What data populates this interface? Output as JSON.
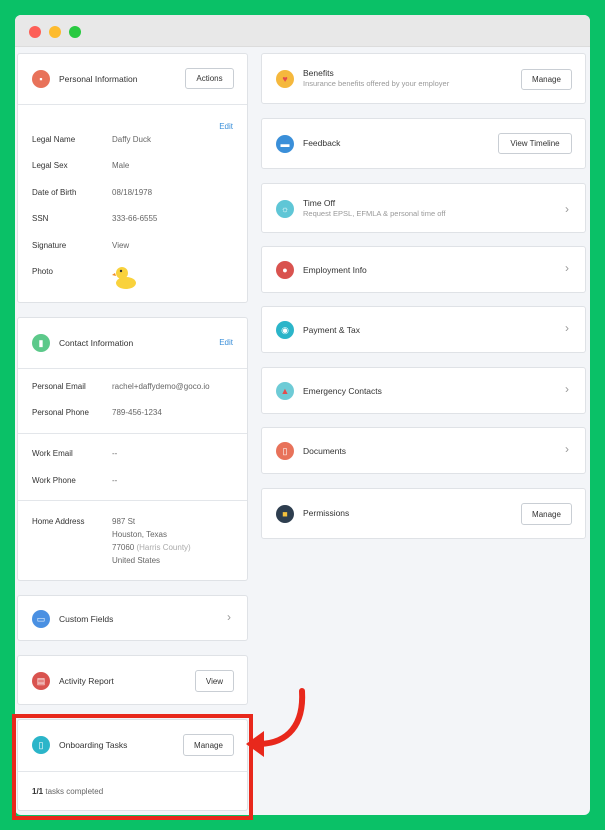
{
  "personal_info": {
    "title": "Personal Information",
    "actions_label": "Actions",
    "edit_label": "Edit",
    "fields": [
      {
        "label": "Legal Name",
        "value": "Daffy Duck"
      },
      {
        "label": "Legal Sex",
        "value": "Male"
      },
      {
        "label": "Date of Birth",
        "value": "08/18/1978"
      },
      {
        "label": "SSN",
        "value": "333-66-6555"
      },
      {
        "label": "Signature",
        "value": "View"
      },
      {
        "label": "Photo",
        "value": ""
      }
    ]
  },
  "contact_info": {
    "title": "Contact Information",
    "edit_label": "Edit",
    "personal_email_label": "Personal Email",
    "personal_email": "rachel+daffydemo@goco.io",
    "personal_phone_label": "Personal Phone",
    "personal_phone": "789-456-1234",
    "work_email_label": "Work Email",
    "work_email": "--",
    "work_phone_label": "Work Phone",
    "work_phone": "--",
    "home_address_label": "Home Address",
    "address_line1": "987 St",
    "address_line2": "Houston, Texas",
    "address_zip": "77060",
    "address_county": "(Harris County)",
    "address_country": "United States"
  },
  "custom_fields": {
    "title": "Custom Fields"
  },
  "activity_report": {
    "title": "Activity Report",
    "button_label": "View"
  },
  "onboarding": {
    "title": "Onboarding Tasks",
    "button_label": "Manage",
    "progress_count": "1/1",
    "progress_text": " tasks completed"
  },
  "right_cards": {
    "benefits": {
      "title": "Benefits",
      "subtitle": "Insurance benefits offered by your employer",
      "button_label": "Manage"
    },
    "feedback": {
      "title": "Feedback",
      "button_label": "View Timeline"
    },
    "time_off": {
      "title": "Time Off",
      "subtitle": "Request EPSL, EFMLA & personal time off"
    },
    "employment": {
      "title": "Employment Info"
    },
    "payment": {
      "title": "Payment & Tax"
    },
    "emergency": {
      "title": "Emergency Contacts"
    },
    "documents": {
      "title": "Documents"
    },
    "permissions": {
      "title": "Permissions",
      "button_label": "Manage"
    }
  },
  "colors": {
    "background": "#0ac167",
    "highlight": "#e8281c",
    "link": "#3a8fd9"
  }
}
